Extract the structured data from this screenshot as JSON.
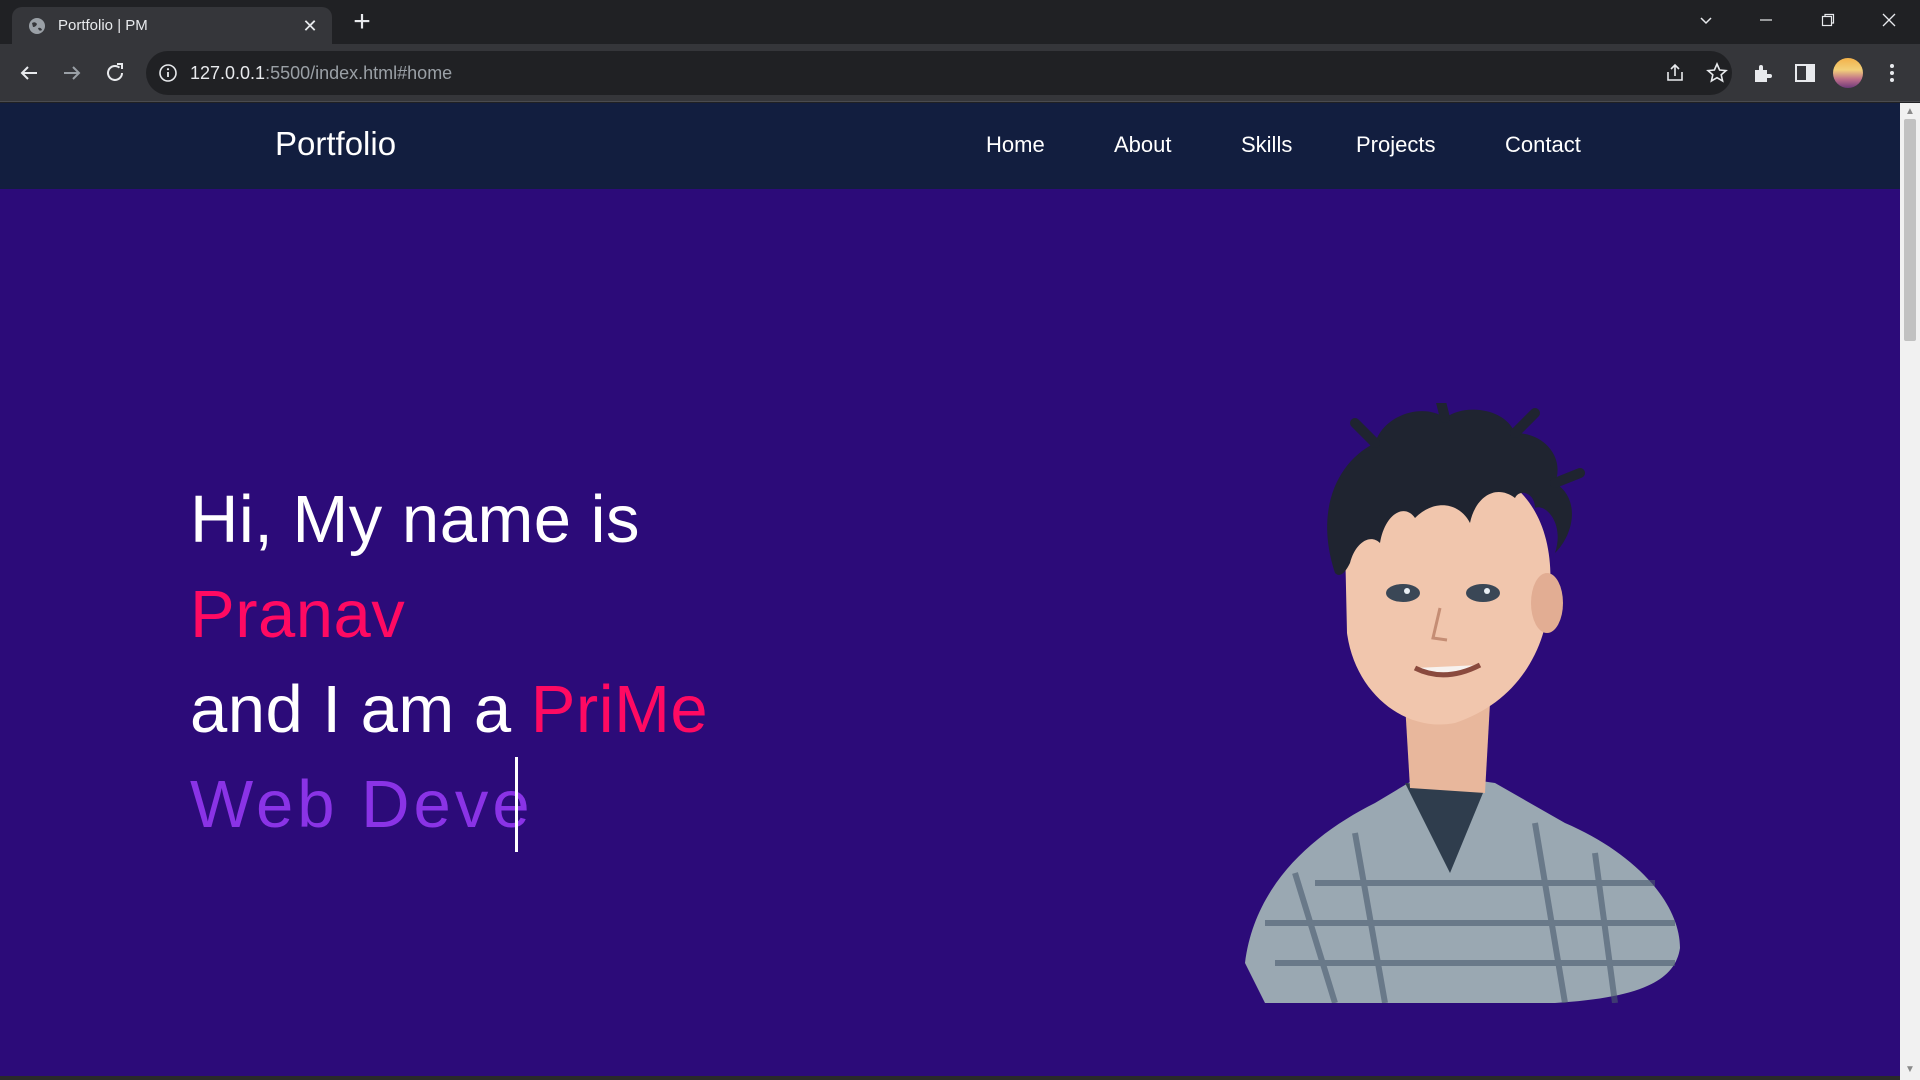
{
  "browser": {
    "tab_title": "Portfolio | PM",
    "tab_close": "✕",
    "new_tab": "+",
    "url_host": "127.0.0.1",
    "url_path": ":5500/index.html#home"
  },
  "nav": {
    "brand": "Portfolio",
    "links": [
      "Home",
      "About",
      "Skills",
      "Projects",
      "Contact"
    ]
  },
  "hero": {
    "greeting": "Hi, My name is",
    "name": "Pranav",
    "role_prefix": "and I am a ",
    "role_accent": "PriMe",
    "typed_text": "Web Deve"
  },
  "colors": {
    "page_bg": "#2c0b79",
    "nav_bg": "#121e3f",
    "accent": "#ff0a62",
    "typed": "#8a33e6"
  },
  "icons": [
    "globe-icon",
    "back-icon",
    "forward-icon",
    "reload-icon",
    "info-icon",
    "share-icon",
    "star-icon",
    "extensions-icon",
    "side-panel-icon",
    "menu-icon"
  ]
}
